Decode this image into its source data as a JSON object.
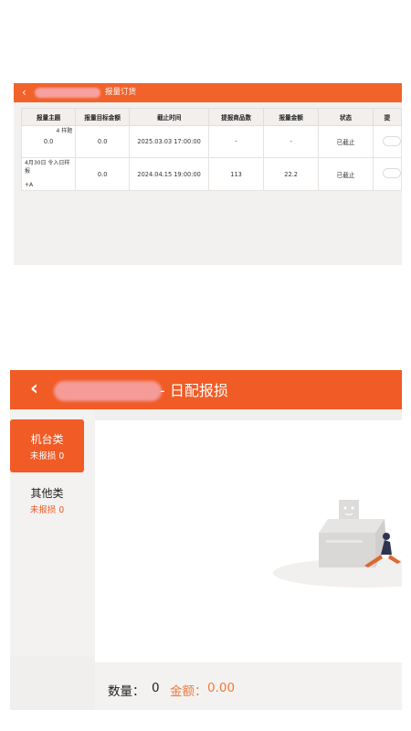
{
  "top_screen": {
    "back_icon": "chevron-left-icon",
    "title": "报量订货",
    "table": {
      "headers": [
        "报量主题",
        "报量目标金额",
        "截止时间",
        "提报商品数",
        "报量金额",
        "状态",
        "提"
      ],
      "rows": [
        {
          "topic": "4 样题",
          "topic_value": "0.0",
          "target": "0.0",
          "deadline": "2025.03.03 17:00:00",
          "items": "-",
          "amount": "-",
          "status": "已截止"
        },
        {
          "topic": "4月30日 令入日样报",
          "topic_value": "+A",
          "target": "0.0",
          "deadline": "2024.04.15 19:00:00",
          "items": "113",
          "amount": "22.2",
          "status": "已截止"
        }
      ]
    }
  },
  "bottom_screen": {
    "back_icon": "chevron-left-icon",
    "title": "- 日配报损",
    "categories": [
      {
        "name": "机台类",
        "sub": "未报损 0"
      },
      {
        "name": "其他类",
        "sub": "未报损 0"
      }
    ],
    "empty_icon": "empty-box-icon",
    "footer": {
      "qty_label": "数量：",
      "qty_value": "0",
      "amount_label": "金额：",
      "amount_value": "0.00"
    }
  },
  "colors": {
    "brand": "#f05b26",
    "background": "#f1efed"
  }
}
